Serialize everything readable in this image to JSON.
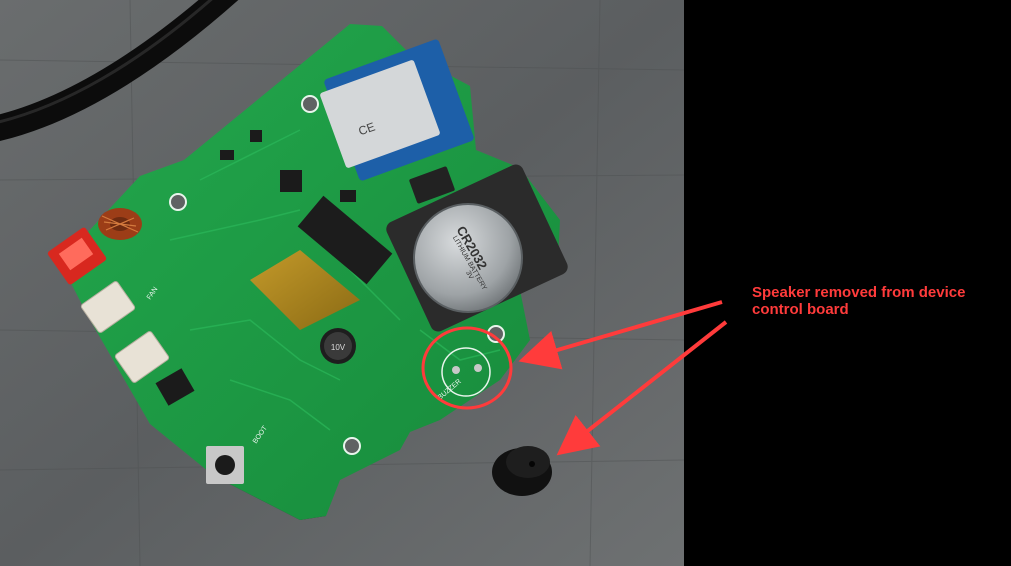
{
  "annotation": {
    "text": "Speaker removed from device control board",
    "color": "#ff3b3b"
  },
  "board_labels": {
    "battery_line1": "CR2032",
    "battery_line2": "LITHIUM BATTERY",
    "battery_line3": "3V",
    "capacitor": "10V",
    "module_mark": "CE",
    "boot": "BOOT",
    "fan": "FAN",
    "buzzer": "BUZZER"
  },
  "colors": {
    "background_surface": "#5f6263",
    "pcb_green": "#1e9a45",
    "black_panel": "#000000"
  }
}
